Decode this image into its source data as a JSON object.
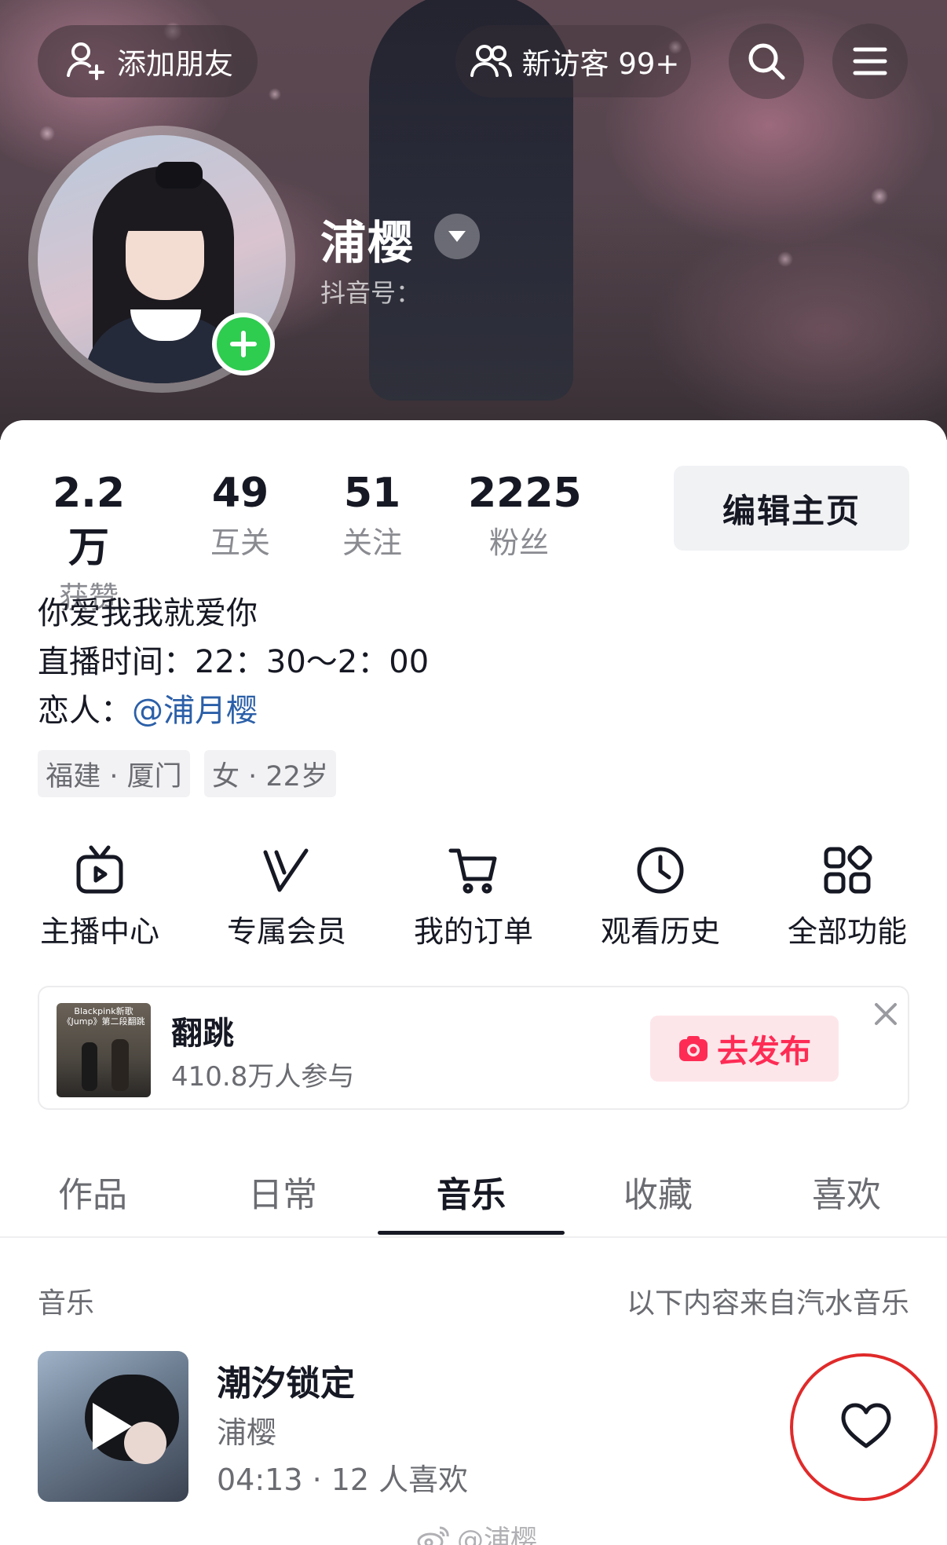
{
  "header": {
    "add_friend_label": "添加朋友",
    "visitors_label": "新访客 99+",
    "nickname": "浦樱",
    "douyin_id_label": "抖音号："
  },
  "stats": [
    {
      "value": "2.2万",
      "label": "获赞"
    },
    {
      "value": "49",
      "label": "互关"
    },
    {
      "value": "51",
      "label": "关注"
    },
    {
      "value": "2225",
      "label": "粉丝"
    }
  ],
  "edit_button_label": "编辑主页",
  "bio": {
    "line1": "你爱我我就爱你",
    "line2": "直播时间：22：30～2：00",
    "line3_prefix": "恋人：",
    "line3_mention": "@浦月樱"
  },
  "tags": [
    "福建 · 厦门",
    "女 · 22岁"
  ],
  "features": [
    {
      "label": "主播中心",
      "icon": "tv-icon"
    },
    {
      "label": "专属会员",
      "icon": "vip-icon"
    },
    {
      "label": "我的订单",
      "icon": "cart-icon"
    },
    {
      "label": "观看历史",
      "icon": "clock-icon"
    },
    {
      "label": "全部功能",
      "icon": "grid-icon"
    }
  ],
  "challenge": {
    "thumb_text": "Blackpink新歌《Jump》第二段翻跳",
    "title": "翻跳",
    "participants": "410.8万人参与",
    "publish_label": "去发布"
  },
  "tabs": [
    {
      "label": "作品",
      "active": false
    },
    {
      "label": "日常",
      "active": false
    },
    {
      "label": "音乐",
      "active": true
    },
    {
      "label": "收藏",
      "active": false
    },
    {
      "label": "喜欢",
      "active": false
    }
  ],
  "music": {
    "section_label": "音乐",
    "source_note": "以下内容来自汽水音乐",
    "song_title": "潮汐锁定",
    "artist": "浦樱",
    "meta": "04:13 · 12 人喜欢"
  },
  "watermark": "@浦樱",
  "colors": {
    "accent": "#fe2c55",
    "add_badge": "#2ecc4f",
    "mention": "#2b5fa8",
    "highlight_ring": "#e02a2a"
  }
}
